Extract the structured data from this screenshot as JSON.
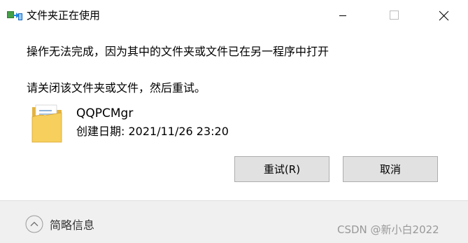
{
  "window": {
    "title": "文件夹正在使用"
  },
  "message": {
    "line1": "操作无法完成，因为其中的文件夹或文件已在另一程序中打开",
    "line2": "请关闭该文件夹或文件，然后重试。"
  },
  "file": {
    "name": "QQPCMgr",
    "date": "创建日期: 2021/11/26 23:20"
  },
  "buttons": {
    "retry": "重试(R)",
    "cancel": "取消"
  },
  "footer": {
    "details": "简略信息",
    "watermark": "CSDN @新小白2022"
  }
}
